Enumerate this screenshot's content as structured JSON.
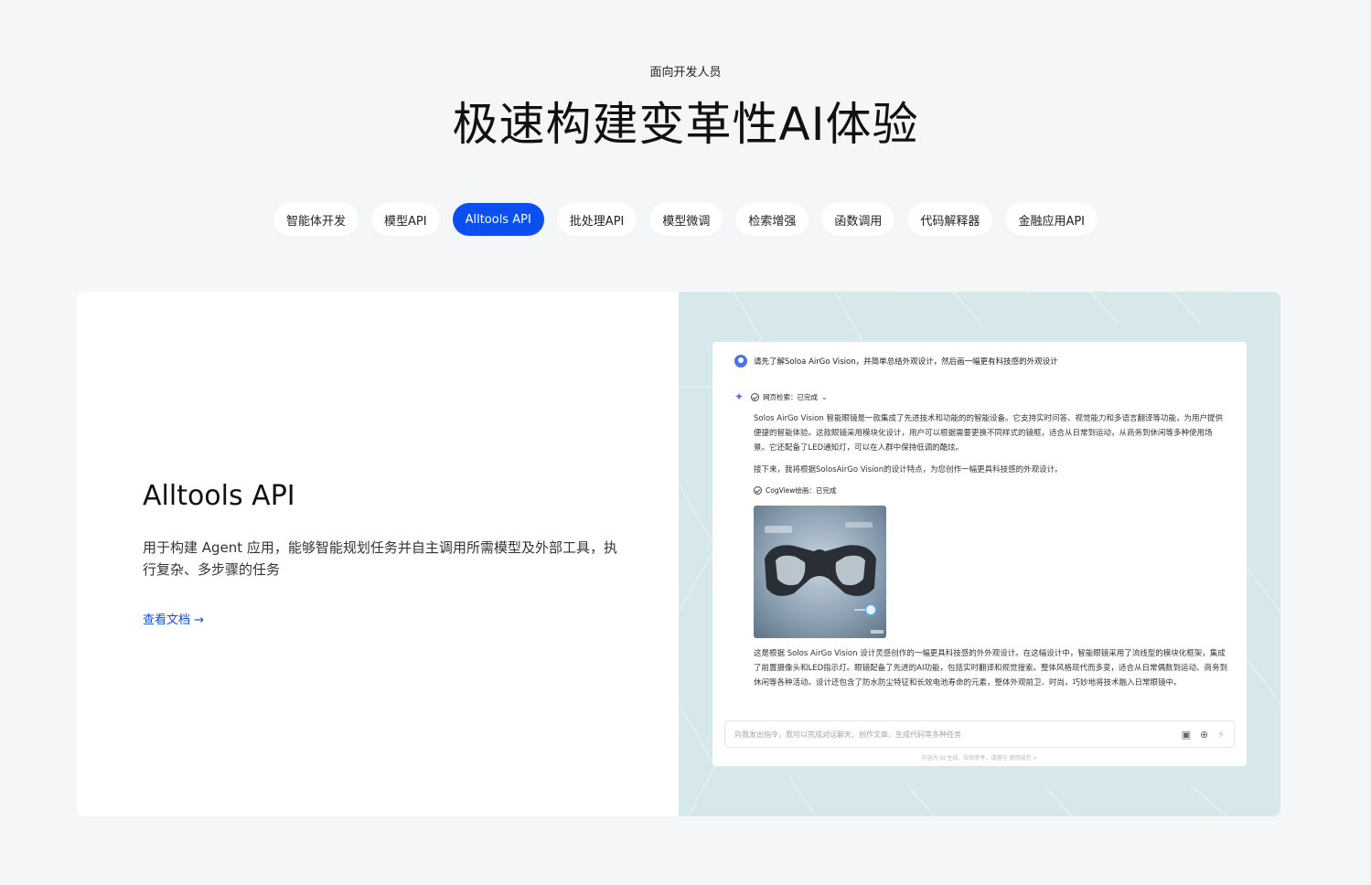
{
  "hero": {
    "eyebrow": "面向开发人员",
    "title": "极速构建变革性AI体验"
  },
  "tabs": [
    {
      "label": "智能体开发",
      "active": false
    },
    {
      "label": "模型API",
      "active": false
    },
    {
      "label": "Alltools API",
      "active": true
    },
    {
      "label": "批处理API",
      "active": false
    },
    {
      "label": "模型微调",
      "active": false
    },
    {
      "label": "检索增强",
      "active": false
    },
    {
      "label": "函数调用",
      "active": false
    },
    {
      "label": "代码解释器",
      "active": false
    },
    {
      "label": "金融应用API",
      "active": false
    }
  ],
  "feature": {
    "title": "Alltools API",
    "description": "用于构建 Agent 应用，能够智能规划任务并自主调用所需模型及外部工具，执行复杂、多步骤的任务",
    "link_label": "查看文档",
    "link_arrow": "→"
  },
  "chat": {
    "user_message": "请先了解Soloa AirGo Vision，并简单总结外观设计，然后画一幅更有科技感的外观设计",
    "web_search_status": "网页检索：已完成",
    "paragraph1": "Solos AirGo Vision 智能眼镜是一款集成了先进技术和功能的的智能设备。它支持实时问答、视觉能力和多语言翻译等功能，为用户提供便捷的智能体验。这款眼镜采用模块化设计，用户可以根据需要更换不同样式的镜框，适合从日常到运动，从商务到休闲等多种使用场景。它还配备了LED通知灯，可以在人群中保持低调的酷炫。",
    "paragraph2": "接下来，我将根据SolosAirGo Vision的设计特点，为您创作一幅更具科技感的外观设计。",
    "cogview_status": "CogView绘画：已完成",
    "paragraph3": "这是根据 Solos AirGo Vision 设计灵感创作的一幅更具科技感的外外观设计。在这幅设计中，智能眼镜采用了流线型的模块化框架，集成了前置摄像头和LED指示灯。眼镜配备了先进的AI功能，包括实时翻译和视觉搜索。整体风格现代而多变，适合从日常偶数到运动、商务到休闲等各种活动。设计还包含了防水防尘特征和长效电池寿命的元素，整体外观前卫、时尚，巧妙地将技术融入日常眼镜中。",
    "input_placeholder": "向我发出指令，我可以完成对话聊天、创作文章、生成代码等多种任务",
    "disclaimer": "内容为 AI 生成，仅供参考，请遵守 使用规范 >"
  },
  "colors": {
    "accent": "#0b4ff0",
    "page_bg": "#f5f6f8",
    "preview_bg": "#d7e8ea"
  }
}
